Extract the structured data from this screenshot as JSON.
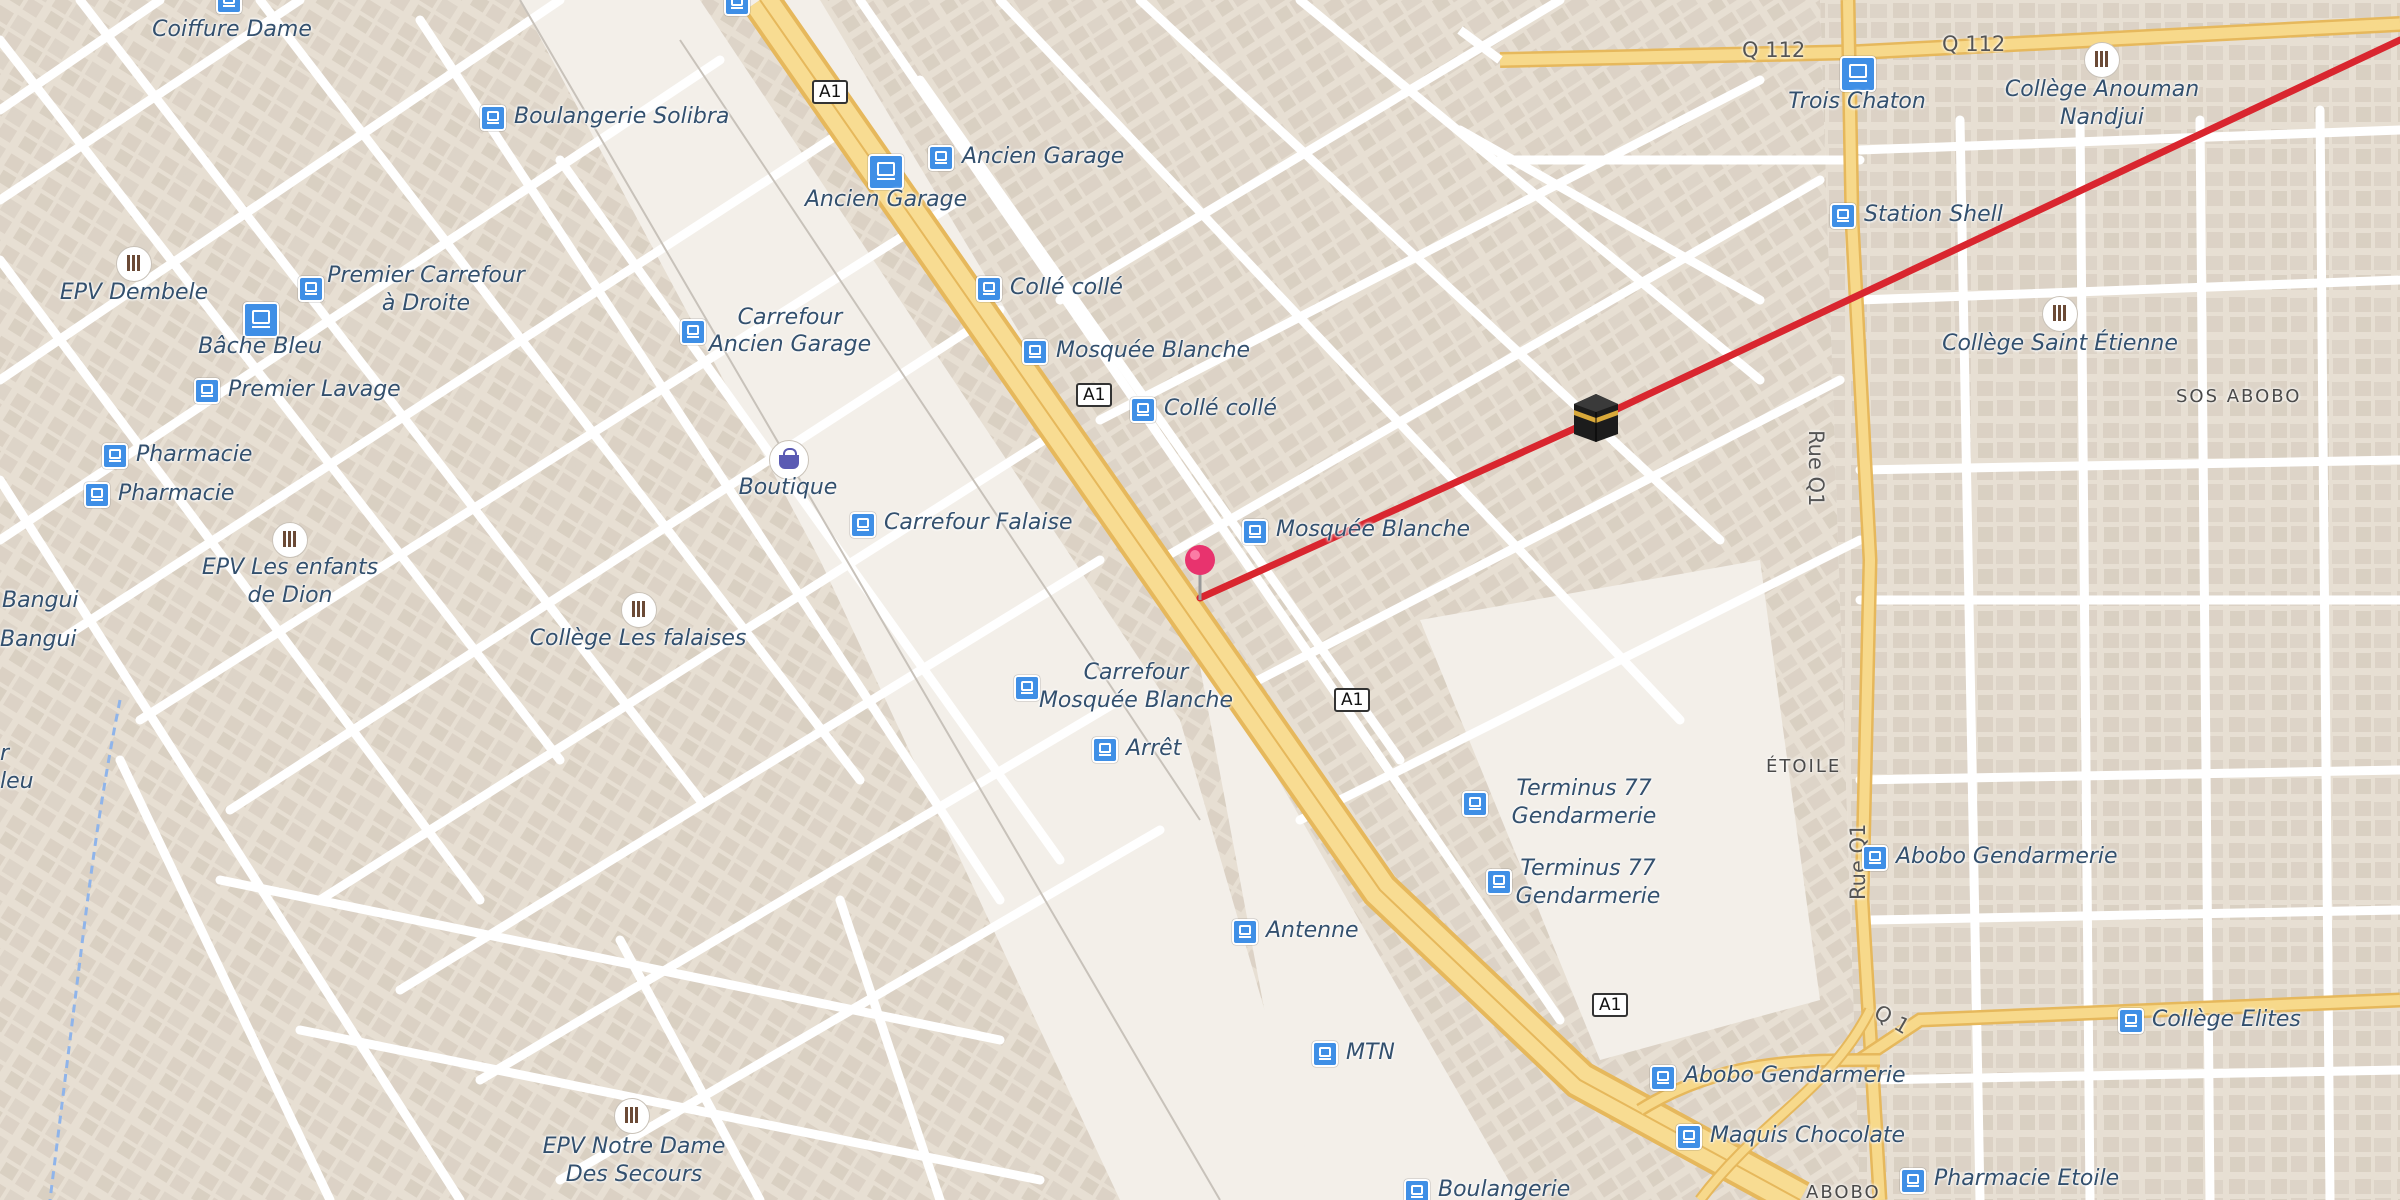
{
  "colors": {
    "background": "#f3efe9",
    "block": "#e7dfd3",
    "building": "#d9d0c3",
    "street": "#ffffff",
    "highway_fill": "#f7d98b",
    "highway_casing": "#e6b85c",
    "route_line": "#d9262f",
    "bus_stop": "#3f8fe6",
    "pin": "#e8336e",
    "label": "#33506e"
  },
  "route_shields": [
    {
      "id": "a1-top",
      "text": "A1"
    },
    {
      "id": "a1-mid",
      "text": "A1"
    },
    {
      "id": "a1-low",
      "text": "A1"
    },
    {
      "id": "a1-bottom",
      "text": "A1"
    }
  ],
  "road_labels": {
    "q112_left": "Q 112",
    "q112_right": "Q 112",
    "rue_q1_top": "Rue Q1",
    "rue_q1_bottom": "Rue Q1",
    "q1": "Q 1"
  },
  "districts": {
    "sos_abobo": "SOS ABOBO",
    "etoile": "ÉTOILE",
    "abobo": "ABOBO"
  },
  "pois": {
    "coiffure_dame": "Coiffure Dame",
    "boulangerie_solibra": "Boulangerie Solibra",
    "ancien_garage_1": "Ancien Garage",
    "ancien_garage_2": "Ancien Garage",
    "epv_dembele": "EPV Dembele",
    "premier_carrefour_1": "Premier Carrefour",
    "premier_carrefour_2": "à Droite",
    "colle_colle_1": "Collé collé",
    "carrefour_ancien_1": "Carrefour",
    "carrefour_ancien_2": "Ancien Garage",
    "bache_bleu": "Bâche Bleu",
    "mosquee_blanche_1": "Mosquée Blanche",
    "premier_lavage": "Premier Lavage",
    "colle_colle_2": "Collé collé",
    "pharmacie_1": "Pharmacie",
    "pharmacie_2": "Pharmacie",
    "boutique": "Boutique",
    "carrefour_falaise": "Carrefour Falaise",
    "mosquee_blanche_2": "Mosquée Blanche",
    "epv_enfants_1": "EPV Les enfants",
    "epv_enfants_2": "de Dion",
    "bangui_1": "Bangui",
    "bangui_2": "Bangui",
    "college_falaises": "Collège Les falaises",
    "carrefour_mosquee_1": "Carrefour",
    "carrefour_mosquee_2": "Mosquée Blanche",
    "arret": "Arrêt",
    "terminus_1a": "Terminus 77",
    "terminus_1b": "Gendarmerie",
    "terminus_2a": "Terminus 77",
    "terminus_2b": "Gendarmerie",
    "antenne": "Antenne",
    "mtn": "MTN",
    "epv_notre_dame_1": "EPV Notre Dame",
    "epv_notre_dame_2": "Des Secours",
    "boulangerie_bottom": "Boulangerie",
    "trois_chaton": "Trois Chaton",
    "college_anouman_1": "Collège Anouman",
    "college_anouman_2": "Nandjui",
    "station_shell": "Station Shell",
    "college_st_etienne": "Collège Saint Étienne",
    "abobo_gendarmerie_1": "Abobo Gendarmerie",
    "abobo_gendarmerie_2": "Abobo Gendarmerie",
    "maquis_chocolate": "Maquis Chocolate",
    "pharmacie_etoile": "Pharmacie Etoile",
    "college_elites": "Collège Elites",
    "edge_r": "r",
    "edge_leu": "leu"
  }
}
